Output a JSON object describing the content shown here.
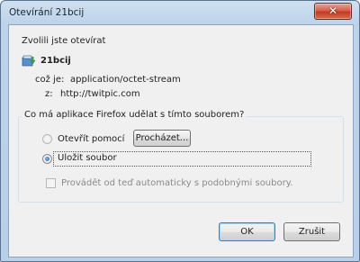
{
  "window": {
    "title": "Otevírání 21bcij",
    "close_glyph": "✕"
  },
  "dialog": {
    "intro": "Zvolili jste otevírat",
    "file_name": "21bcij",
    "type_label": "což je:",
    "type_value": "application/octet-stream",
    "from_label": "z:",
    "from_value": "http://twitpic.com",
    "question": "Co má aplikace Firefox udělat s tímto souborem?",
    "options": [
      {
        "label": "Otevřít pomocí",
        "selected": false
      },
      {
        "label": "Uložit soubor",
        "selected": true
      }
    ],
    "browse_label": "Procházet...",
    "auto_label": "Provádět od teď automaticky s podobnými soubory.",
    "auto_checked": false,
    "ok_label": "OK",
    "cancel_label": "Zrušit"
  },
  "icons": {
    "file": "file-download-icon",
    "close": "close-icon"
  }
}
